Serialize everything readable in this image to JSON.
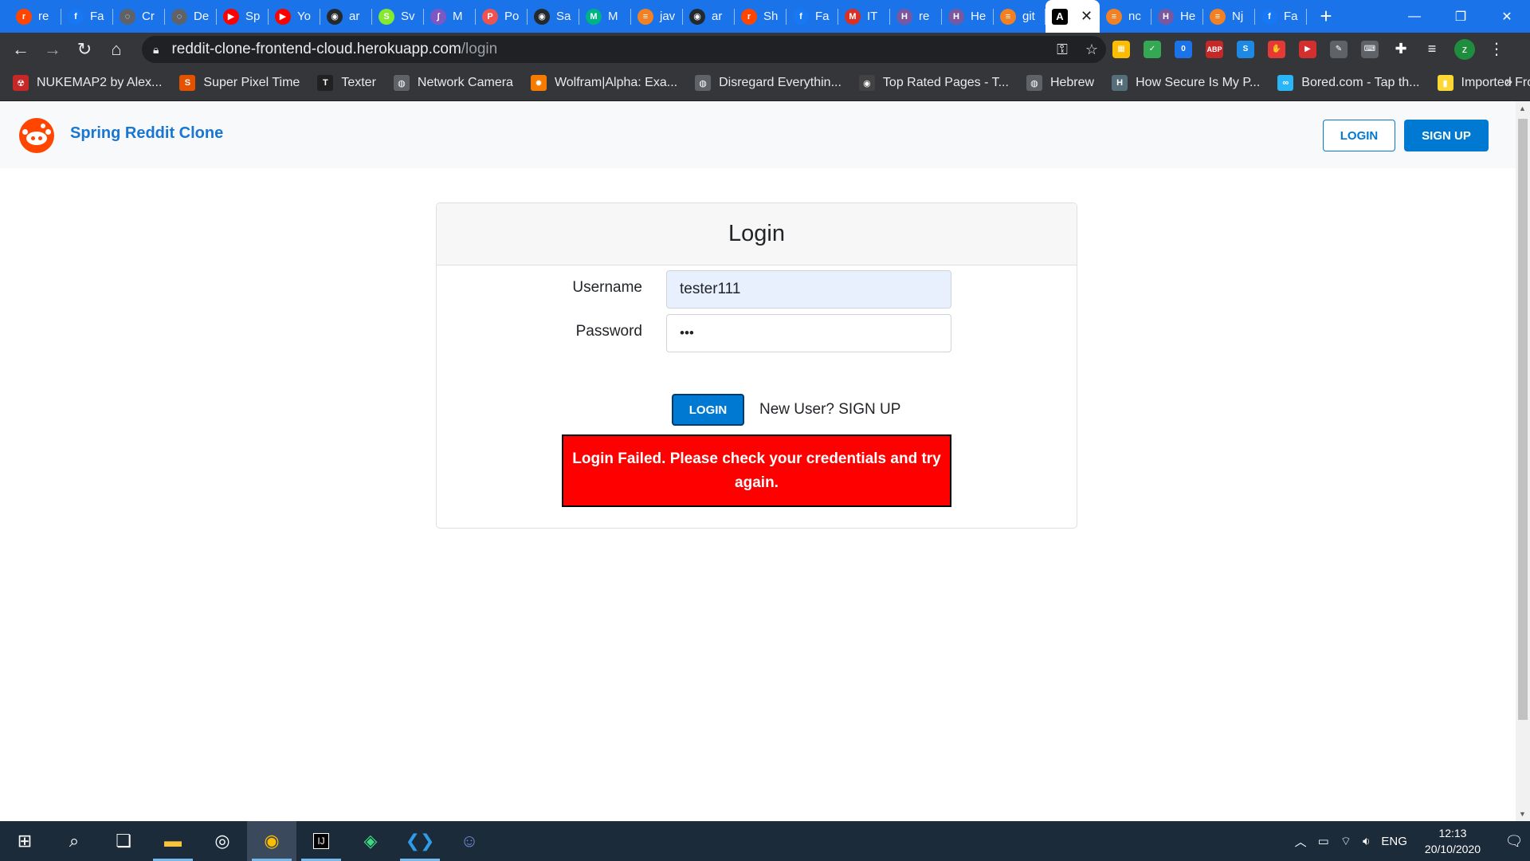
{
  "browser": {
    "tabs": [
      {
        "icon": "reddit-icon",
        "label": "re",
        "color": "#ff4500",
        "glyph": "r"
      },
      {
        "icon": "facebook-icon",
        "label": "Fa",
        "color": "#1877f2",
        "glyph": "f"
      },
      {
        "icon": "globe-icon",
        "label": "Cr",
        "color": "#5f6368",
        "glyph": "◌"
      },
      {
        "icon": "globe-icon",
        "label": "De",
        "color": "#5f6368",
        "glyph": "◌"
      },
      {
        "icon": "youtube-icon",
        "label": "Sp",
        "color": "#ff0000",
        "glyph": "▶"
      },
      {
        "icon": "youtube-icon",
        "label": "Yo",
        "color": "#ff0000",
        "glyph": "▶"
      },
      {
        "icon": "github-icon",
        "label": "ar",
        "color": "#24292e",
        "glyph": "◉"
      },
      {
        "icon": "swagger-icon",
        "label": "Sv",
        "color": "#85ea2d",
        "glyph": "S"
      },
      {
        "icon": "page-icon",
        "label": "M",
        "color": "#7e57c2",
        "glyph": "∫"
      },
      {
        "icon": "page-icon",
        "label": "Po",
        "color": "#ef5350",
        "glyph": "P"
      },
      {
        "icon": "github-icon",
        "label": "Sa",
        "color": "#24292e",
        "glyph": "◉"
      },
      {
        "icon": "gmail-icon",
        "label": "M",
        "color": "#00b386",
        "glyph": "M"
      },
      {
        "icon": "stackoverflow-icon",
        "label": "jav",
        "color": "#f48024",
        "glyph": "≡"
      },
      {
        "icon": "github-icon",
        "label": "ar",
        "color": "#24292e",
        "glyph": "◉"
      },
      {
        "icon": "reddit-icon",
        "label": "Sh",
        "color": "#ff4500",
        "glyph": "r"
      },
      {
        "icon": "facebook-icon",
        "label": "Fa",
        "color": "#1877f2",
        "glyph": "f"
      },
      {
        "icon": "gmail-icon",
        "label": "IT",
        "color": "#d93025",
        "glyph": "M"
      },
      {
        "icon": "heroku-icon",
        "label": "re",
        "color": "#79589f",
        "glyph": "H"
      },
      {
        "icon": "heroku-icon",
        "label": "He",
        "color": "#79589f",
        "glyph": "H"
      },
      {
        "icon": "stackoverflow-icon",
        "label": "git",
        "color": "#f48024",
        "glyph": "≡"
      }
    ],
    "active_tab": {
      "icon": "a-icon",
      "glyph": "A",
      "close": "✕"
    },
    "tabs_after": [
      {
        "icon": "stackoverflow-icon",
        "label": "nc",
        "color": "#f48024",
        "glyph": "≡"
      },
      {
        "icon": "heroku-icon",
        "label": "He",
        "color": "#79589f",
        "glyph": "H"
      },
      {
        "icon": "stackoverflow-icon",
        "label": "Nj",
        "color": "#f48024",
        "glyph": "≡"
      },
      {
        "icon": "facebook-icon",
        "label": "Fa",
        "color": "#1877f2",
        "glyph": "f"
      }
    ],
    "new_tab": "+",
    "url_host": "reddit-clone-frontend-cloud.herokuapp.com",
    "url_path": "/login",
    "bookmarks": [
      {
        "label": "NUKEMAP2 by Alex...",
        "color": "#c62828",
        "glyph": "☢"
      },
      {
        "label": "Super Pixel Time",
        "color": "#e65100",
        "glyph": "S"
      },
      {
        "label": "Texter",
        "color": "#212121",
        "glyph": "T"
      },
      {
        "label": "Network Camera",
        "color": "#5f6368",
        "glyph": "◍"
      },
      {
        "label": "Wolfram|Alpha: Exa...",
        "color": "#f57c00",
        "glyph": "✹"
      },
      {
        "label": "Disregard Everythin...",
        "color": "#5f6368",
        "glyph": "◍"
      },
      {
        "label": "Top Rated Pages - T...",
        "color": "#424242",
        "glyph": "◉"
      },
      {
        "label": "Hebrew",
        "color": "#5f6368",
        "glyph": "◍"
      },
      {
        "label": "How Secure Is My P...",
        "color": "#546e7a",
        "glyph": "H"
      },
      {
        "label": "Bored.com - Tap th...",
        "color": "#29b6f6",
        "glyph": "∞"
      },
      {
        "label": "Imported From Fire...",
        "color": "#fdd835",
        "glyph": "▮"
      }
    ],
    "more_bookmarks": "»"
  },
  "app": {
    "brand": "Spring Reddit Clone",
    "header_login": "LOGIN",
    "header_signup": "SIGN UP",
    "login_card": {
      "title": "Login",
      "username_label": "Username",
      "username_value": "tester111",
      "password_label": "Password",
      "password_value": "•••",
      "login_button": "LOGIN",
      "signup_prompt": "New User? SIGN UP",
      "error_message": "Login Failed. Please check your credentials and try again."
    }
  },
  "taskbar": {
    "language": "ENG",
    "time": "12:13",
    "date": "20/10/2020"
  },
  "colors": {
    "chrome_blue": "#1a73e8",
    "reddit_orange": "#ff4500",
    "button_blue": "#0079d3",
    "error_red": "#ff0000"
  }
}
